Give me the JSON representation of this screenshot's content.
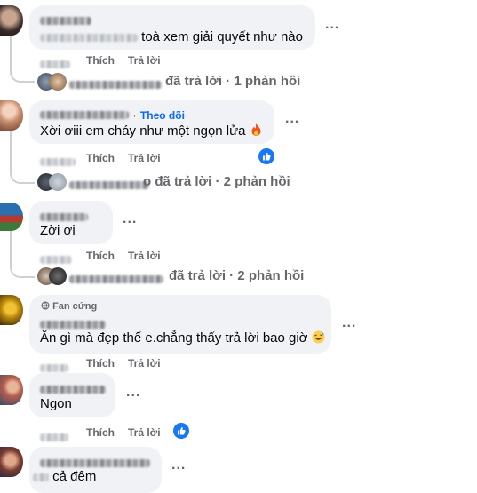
{
  "icons": {
    "like": "thumbs-up-icon",
    "fire": "fire-emoji",
    "laugh": "grinning-sweat-emoji",
    "badge": "globe-icon",
    "more": "more-options-icon"
  },
  "colors": {
    "bubble": "#f0f2f5",
    "action": "#65676b",
    "link": "#0866ff",
    "like_badge": "#1877f2"
  },
  "comments": [
    {
      "text_visible": "toà xem giải quyết như nào",
      "actions": {
        "like": "Thích",
        "reply": "Trả lời"
      },
      "replies_summary": "đã trả lời · 1 phản hồi"
    },
    {
      "follow": "Theo dõi",
      "text": "Xời ơiii em cháy như một ngọn lửa",
      "actions": {
        "like": "Thích",
        "reply": "Trả lời"
      },
      "replies_summary": "o đã trả lời · 2 phản hồi"
    },
    {
      "text": "Zời ơi",
      "actions": {
        "like": "Thích",
        "reply": "Trả lời"
      },
      "replies_summary": "đã trả lời · 2 phản hồi"
    },
    {
      "badge": "Fan cứng",
      "text": "Ăn gì mà đẹp thế e.chẳng thấy trả lời bao giờ",
      "actions": {
        "like": "Thích",
        "reply": "Trả lời"
      }
    },
    {
      "text": "Ngon",
      "actions": {
        "like": "Thích",
        "reply": "Trả lời"
      }
    },
    {
      "text_visible": "cả đêm"
    }
  ],
  "more": "..."
}
